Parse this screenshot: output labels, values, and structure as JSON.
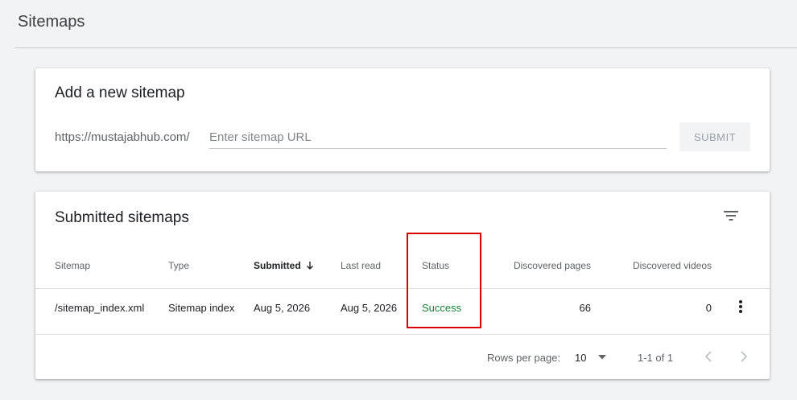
{
  "page": {
    "title": "Sitemaps"
  },
  "add_sitemap": {
    "title": "Add a new sitemap",
    "url_prefix": "https://mustajabhub.com/",
    "input_placeholder": "Enter sitemap URL",
    "input_value": "",
    "submit_label": "SUBMIT"
  },
  "submitted": {
    "title": "Submitted sitemaps",
    "columns": {
      "sitemap": "Sitemap",
      "type": "Type",
      "submitted": "Submitted",
      "last_read": "Last read",
      "status": "Status",
      "discovered_pages": "Discovered pages",
      "discovered_videos": "Discovered videos"
    },
    "sorted_column": "submitted",
    "rows": [
      {
        "sitemap": "/sitemap_index.xml",
        "type": "Sitemap index",
        "submitted": "Aug 5, 2026",
        "last_read": "Aug 5, 2026",
        "status": "Success",
        "discovered_pages": "66",
        "discovered_videos": "0"
      }
    ],
    "footer": {
      "rows_per_page_label": "Rows per page:",
      "rows_per_page_value": "10",
      "range": "1-1 of 1"
    }
  },
  "colors": {
    "status_success": "#188038",
    "highlight": "#d90000",
    "background": "#f1f3f4"
  },
  "icons": [
    "filter-icon",
    "sort-arrow-down-icon",
    "more-vert-icon",
    "dropdown-arrow-icon",
    "chevron-left-icon",
    "chevron-right-icon"
  ]
}
